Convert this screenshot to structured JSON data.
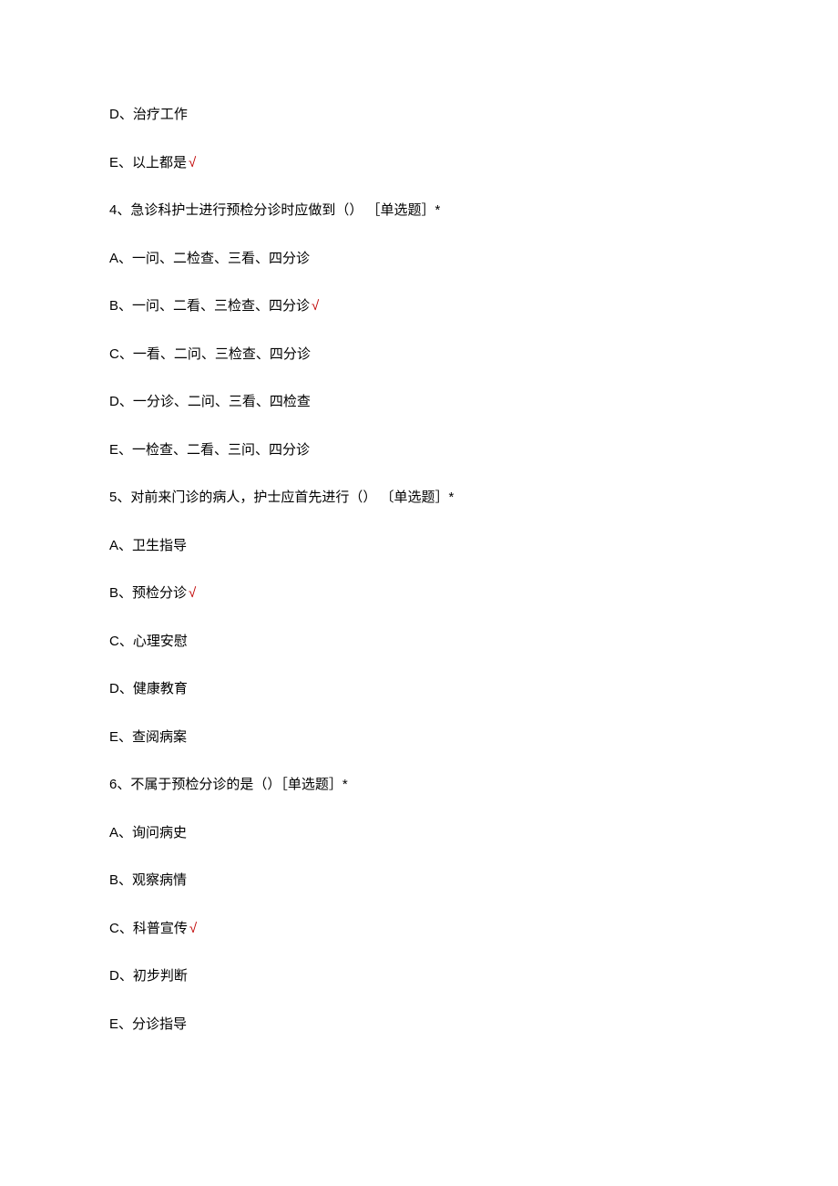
{
  "correct_mark": "√",
  "lines": [
    {
      "type": "option",
      "text": "D、治疗工作",
      "correct": false
    },
    {
      "type": "option",
      "text": "E、以上都是",
      "correct": true
    },
    {
      "type": "question",
      "text": "4、急诊科护士进行预检分诊时应做到（） ［单选题］*"
    },
    {
      "type": "option",
      "text": "A、一问、二检查、三看、四分诊",
      "correct": false
    },
    {
      "type": "option",
      "text": "B、一问、二看、三检查、四分诊",
      "correct": true
    },
    {
      "type": "option",
      "text": "C、一看、二问、三检查、四分诊",
      "correct": false
    },
    {
      "type": "option",
      "text": "D、一分诊、二问、三看、四检查",
      "correct": false
    },
    {
      "type": "option",
      "text": "E、一检查、二看、三问、四分诊",
      "correct": false
    },
    {
      "type": "question",
      "text": "5、对前来门诊的病人，护士应首先进行（） 〔单选题］*"
    },
    {
      "type": "option",
      "text": "A、卫生指导",
      "correct": false
    },
    {
      "type": "option",
      "text": "B、预检分诊",
      "correct": true
    },
    {
      "type": "option",
      "text": "C、心理安慰",
      "correct": false
    },
    {
      "type": "option",
      "text": "D、健康教育",
      "correct": false
    },
    {
      "type": "option",
      "text": "E、查阅病案",
      "correct": false
    },
    {
      "type": "question",
      "text": "6、不属于预检分诊的是（）［单选题］*"
    },
    {
      "type": "option",
      "text": "A、询问病史",
      "correct": false
    },
    {
      "type": "option",
      "text": "B、观察病情",
      "correct": false
    },
    {
      "type": "option",
      "text": "C、科普宣传",
      "correct": true
    },
    {
      "type": "option",
      "text": "D、初步判断",
      "correct": false
    },
    {
      "type": "option",
      "text": "E、分诊指导",
      "correct": false
    }
  ]
}
